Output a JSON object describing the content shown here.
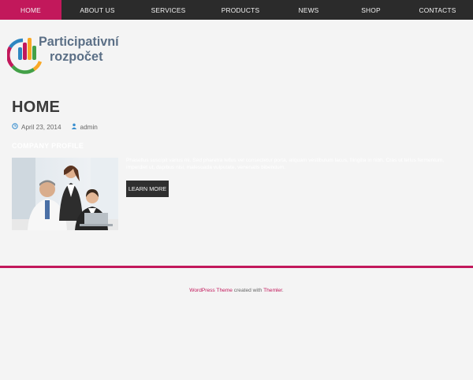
{
  "nav": {
    "items": [
      {
        "label": "HOME",
        "active": true
      },
      {
        "label": "ABOUT US",
        "active": false
      },
      {
        "label": "SERVICES",
        "active": false
      },
      {
        "label": "PRODUCTS",
        "active": false
      },
      {
        "label": "NEWS",
        "active": false
      },
      {
        "label": "SHOP",
        "active": false
      },
      {
        "label": "CONTACTS",
        "active": false
      }
    ],
    "active_color": "#c2185b",
    "bar_color": "#2b2b2b"
  },
  "logo": {
    "line1": "Participativní",
    "line2": "rozpočet",
    "text_color": "#5b6f86"
  },
  "post": {
    "title": "HOME",
    "date": "April 23, 2014",
    "author": "admin",
    "date_icon": "clock-icon",
    "author_icon": "user-icon"
  },
  "section": {
    "heading": "COMPANY PROFILE",
    "body": "Phasellus suscipit varius mi. Sed pharetra tellus vel consectetur porta, aliquam vestibulum lacus, fringilla in nibh. Cras ut tellus fermentum, imperdiet ut, dapibus nisi, malesuada vulputate, venenatis bibendum.",
    "button_label": "LEARN MORE",
    "photo_alt": "team-photo"
  },
  "footer": {
    "link1": "WordPress Theme",
    "middle": " created with ",
    "link2": "Themler",
    "end": ".",
    "accent_color": "#c2185b"
  }
}
